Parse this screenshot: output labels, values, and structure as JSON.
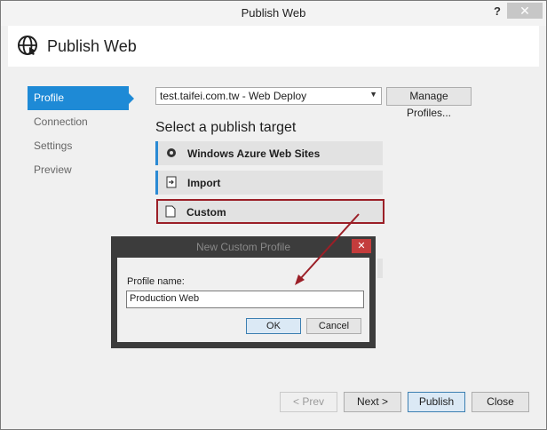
{
  "window": {
    "title": "Publish Web",
    "help": "?",
    "close": "✕"
  },
  "header": {
    "title": "Publish Web",
    "icon": "globe-icon"
  },
  "nav": {
    "items": [
      {
        "label": "Profile",
        "active": true
      },
      {
        "label": "Connection",
        "active": false
      },
      {
        "label": "Settings",
        "active": false
      },
      {
        "label": "Preview",
        "active": false
      }
    ]
  },
  "profile": {
    "selected": "test.taifei.com.tw - Web Deploy",
    "manage_label": "Manage Profiles..."
  },
  "targets": {
    "heading": "Select a publish target",
    "items": [
      {
        "label": "Windows Azure Web Sites",
        "icon": "azure-icon"
      },
      {
        "label": "Import",
        "icon": "import-icon"
      },
      {
        "label": "Custom",
        "icon": "document-icon"
      }
    ]
  },
  "dialog": {
    "title": "New Custom Profile",
    "close": "✕",
    "field_label": "Profile name:",
    "field_value": "Production Web",
    "ok": "OK",
    "cancel": "Cancel"
  },
  "footer": {
    "prev": "< Prev",
    "next": "Next >",
    "publish": "Publish",
    "close": "Close"
  },
  "colors": {
    "accent": "#1e8ad6",
    "highlight_border": "#9b1f27",
    "dialog_frame": "#3c3c3c"
  }
}
